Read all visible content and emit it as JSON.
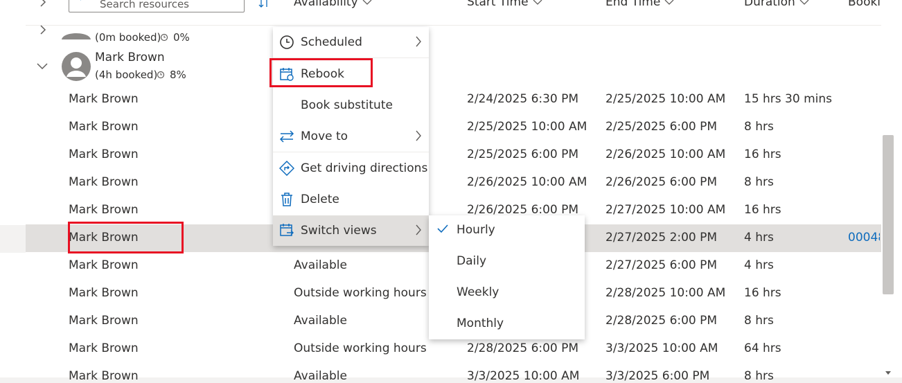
{
  "header": {
    "search_placeholder": "Search resources",
    "columns": [
      "Availability",
      "Start Time",
      "End Time",
      "Duration",
      "Booki"
    ]
  },
  "resources": [
    {
      "name": "",
      "booked": "(0m booked)",
      "percent": "0%"
    },
    {
      "name": "Mark Brown",
      "booked": "(4h booked)",
      "percent": "8%"
    }
  ],
  "rows": [
    {
      "name": "Mark Brown",
      "availability": "",
      "start": "2/24/2025 6:30 PM",
      "end": "2/25/2025 10:00 AM",
      "duration": "15 hrs 30 mins",
      "booking": ""
    },
    {
      "name": "Mark Brown",
      "availability": "",
      "start": "2/25/2025 10:00 AM",
      "end": "2/25/2025 6:00 PM",
      "duration": "8 hrs",
      "booking": ""
    },
    {
      "name": "Mark Brown",
      "availability": "",
      "start": "2/25/2025 6:00 PM",
      "end": "2/26/2025 10:00 AM",
      "duration": "16 hrs",
      "booking": ""
    },
    {
      "name": "Mark Brown",
      "availability": "",
      "start": "2/26/2025 10:00 AM",
      "end": "2/26/2025 6:00 PM",
      "duration": "8 hrs",
      "booking": ""
    },
    {
      "name": "Mark Brown",
      "availability": "",
      "start": "2/26/2025 6:00 PM",
      "end": "2/27/2025 10:00 AM",
      "duration": "16 hrs",
      "booking": ""
    },
    {
      "name": "Mark Brown",
      "availability": "",
      "start": "",
      "end": "2/27/2025 2:00 PM",
      "duration": "4 hrs",
      "booking": "00048"
    },
    {
      "name": "Mark Brown",
      "availability": "Available",
      "start": "",
      "end": "2/27/2025 6:00 PM",
      "duration": "4 hrs",
      "booking": ""
    },
    {
      "name": "Mark Brown",
      "availability": "Outside working hours",
      "start": "",
      "end": "2/28/2025 10:00 AM",
      "duration": "16 hrs",
      "booking": ""
    },
    {
      "name": "Mark Brown",
      "availability": "Available",
      "start": "",
      "end": "2/28/2025 6:00 PM",
      "duration": "8 hrs",
      "booking": ""
    },
    {
      "name": "Mark Brown",
      "availability": "Outside working hours",
      "start": "2/28/2025 6:00 PM",
      "end": "3/3/2025 10:00 AM",
      "duration": "64 hrs",
      "booking": ""
    },
    {
      "name": "Mark Brown",
      "availability": "Available",
      "start": "3/3/2025 10:00 AM",
      "end": "3/3/2025 6:00 PM",
      "duration": "8 hrs",
      "booking": ""
    }
  ],
  "context_menu": {
    "items": [
      "Scheduled",
      "Rebook",
      "Book substitute",
      "Move to",
      "Get driving directions",
      "Delete",
      "Switch views"
    ]
  },
  "submenu": {
    "items": [
      "Hourly",
      "Daily",
      "Weekly",
      "Monthly"
    ],
    "selected": "Hourly"
  },
  "colors": {
    "accent": "#0f6cbd",
    "highlight": "#e81123",
    "selected_row": "#e1dfdd"
  }
}
